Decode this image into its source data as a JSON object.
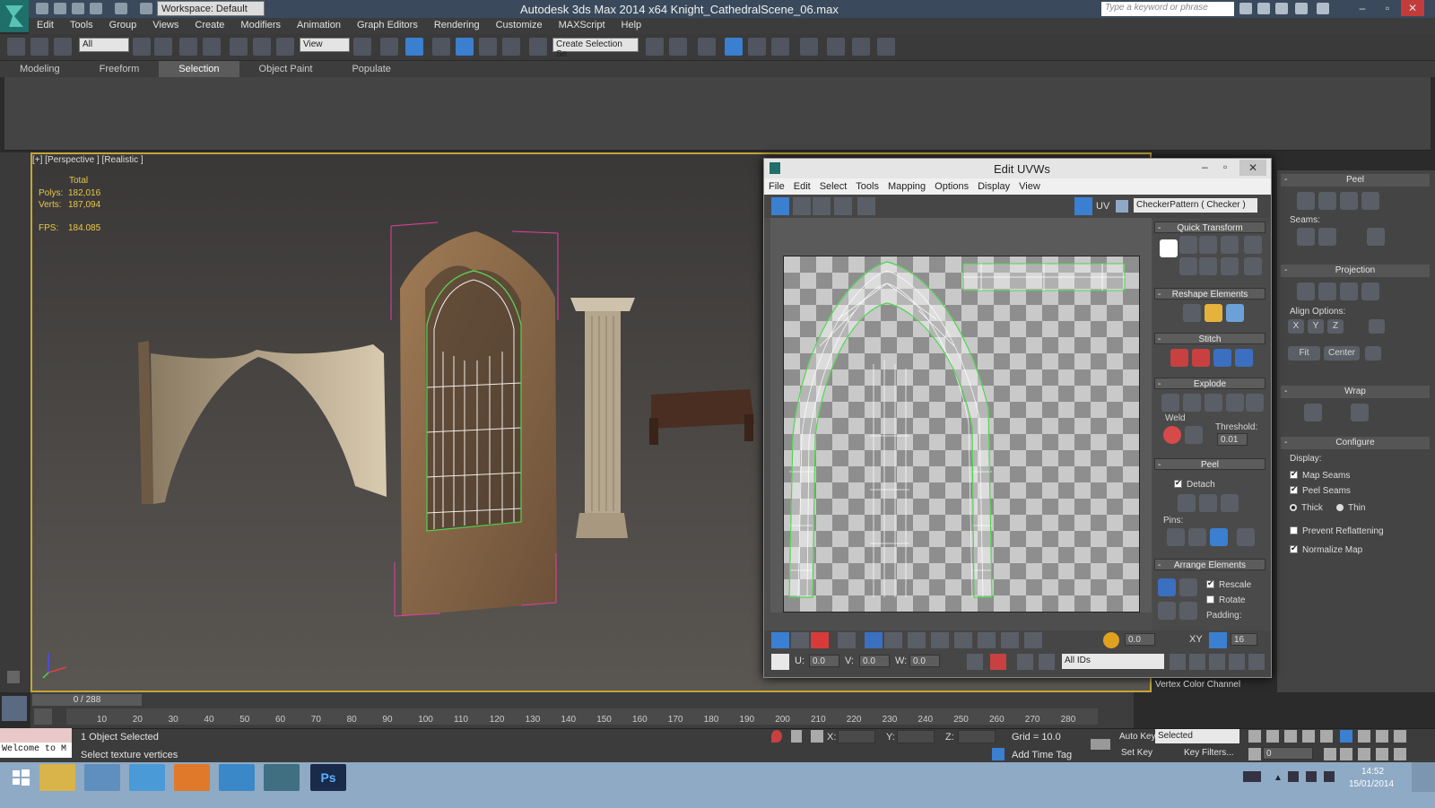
{
  "app": {
    "title": "Autodesk 3ds Max  2014 x64      Knight_CathedralScene_06.max",
    "workspace": "Workspace: Default",
    "search_placeholder": "Type a keyword or phrase"
  },
  "menu": [
    "Edit",
    "Tools",
    "Group",
    "Views",
    "Create",
    "Modifiers",
    "Animation",
    "Graph Editors",
    "Rendering",
    "Customize",
    "MAXScript",
    "Help"
  ],
  "toolbar": {
    "selection_filter": "All",
    "ref_coord": "View",
    "named_selection": "Create Selection Se",
    "snap_angle": "3",
    "colors": {
      "active": "#3b7fd0"
    }
  },
  "ribbon": {
    "tabs": [
      "Modeling",
      "Freeform",
      "Selection",
      "Object Paint",
      "Populate"
    ],
    "active": "Selection"
  },
  "viewport": {
    "label": "[+] [Perspective ] [Realistic ]",
    "stats_header": "Total",
    "polys_label": "Polys:",
    "polys": "182,016",
    "verts_label": "Verts:",
    "verts": "187,094",
    "fps_label": "FPS:",
    "fps": "184.085",
    "axis_icon": "xyz-axis-icon"
  },
  "uvw": {
    "title": "Edit UVWs",
    "menu": [
      "File",
      "Edit",
      "Select",
      "Tools",
      "Mapping",
      "Options",
      "Display",
      "View"
    ],
    "uv_label": "UV",
    "texture": "CheckerPattern  ( Checker )",
    "sections": {
      "quick_transform": "Quick Transform",
      "reshape": "Reshape Elements",
      "stitch": "Stitch",
      "explode": "Explode",
      "peel": "Peel",
      "arrange": "Arrange Elements"
    },
    "weld_label": "Weld",
    "threshold_label": "Threshold:",
    "threshold": "0.01",
    "detach_label": "Detach",
    "pins_label": "Pins:",
    "rescale_label": "Rescale",
    "rotate_label": "Rotate",
    "padding_label": "Padding:",
    "spinner_value": "0.0",
    "grid_value": "16",
    "u_label": "U:",
    "u": "0.0",
    "v_label": "V:",
    "v": "0.0",
    "w_label": "W:",
    "w": "0.0",
    "ids": "All IDs",
    "xy_label": "XY",
    "vertex_color_channel": "Vertex Color Channel"
  },
  "cmdpanel": {
    "peel_header": "Peel",
    "seams_label": "Seams:",
    "projection_header": "Projection",
    "align_label": "Align Options:",
    "align_x": "X",
    "align_y": "Y",
    "align_z": "Z",
    "fit": "Fit",
    "center": "Center",
    "wrap_header": "Wrap",
    "configure_header": "Configure",
    "display_label": "Display:",
    "map_seams": "Map Seams",
    "peel_seams": "Peel Seams",
    "thick": "Thick",
    "thin": "Thin",
    "prevent_reflattening": "Prevent Reflattening",
    "normalize_map": "Normalize Map"
  },
  "timeline": {
    "slider": "0 / 288",
    "ticks": [
      "10",
      "20",
      "30",
      "40",
      "50",
      "60",
      "70",
      "80",
      "90",
      "100",
      "110",
      "120",
      "130",
      "140",
      "150",
      "160",
      "170",
      "180",
      "190",
      "200",
      "210",
      "220",
      "230",
      "240",
      "250",
      "260",
      "270",
      "280"
    ]
  },
  "status": {
    "maxscript": "Welcome to M",
    "selected": "1 Object Selected",
    "prompt": "Select texture vertices",
    "x_label": "X:",
    "y_label": "Y:",
    "z_label": "Z:",
    "grid": "Grid = 10.0",
    "add_time_tag": "Add Time Tag",
    "auto_key": "Auto Key",
    "set_key": "Set Key",
    "key_mode": "Selected",
    "key_filters": "Key Filters...",
    "frame": "0"
  },
  "taskbar": {
    "time": "14:52",
    "date": "15/01/2014"
  }
}
